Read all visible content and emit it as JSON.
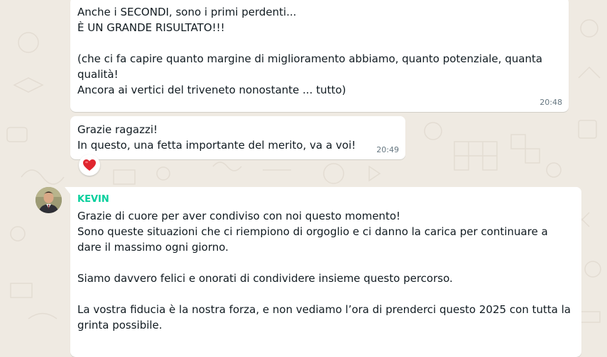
{
  "messages": [
    {
      "text": "Anche i SECONDI, sono i primi perdenti...\nÈ UN GRANDE RISULTATO!!!\n\n(che ci fa capire quanto margine di miglioramento abbiamo, quanto potenziale, quanta qualità!\nAncora ai vertici del triveneto nonostante ... tutto)",
      "time": "20:48"
    },
    {
      "text": "Grazie ragazzi!\nIn questo, una fetta importante del merito, va a voi!",
      "time": "20:49",
      "reaction": "heart-emoji"
    },
    {
      "sender": "KEVIN",
      "text": "Grazie di cuore per aver condiviso con noi questo momento!\nSono queste situazioni che ci riempiono di orgoglio e ci danno la carica per continuare a dare il massimo ogni giorno.\n\nSiamo davvero felici e onorati di condividere insieme questo percorso.\n\nLa vostra fiducia è la nostra forza, e non vediamo l’ora di prenderci questo 2025 con tutta la grinta possibile."
    }
  ],
  "colors": {
    "chat_background": "#efeae2",
    "bubble": "#ffffff",
    "sender_name": "#06cf9c",
    "timestamp": "#667781",
    "reaction_heart": "#e0262f"
  }
}
